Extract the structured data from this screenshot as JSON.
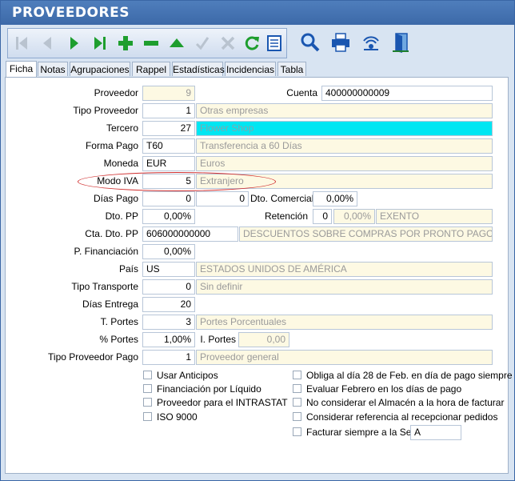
{
  "window": {
    "title": "PROVEEDORES"
  },
  "toolbar": {
    "buttons": [
      {
        "name": "first-record-button",
        "icon": "first-icon"
      },
      {
        "name": "previous-record-button",
        "icon": "previous-icon"
      },
      {
        "name": "next-record-button",
        "icon": "next-icon"
      },
      {
        "name": "last-record-button",
        "icon": "last-icon"
      },
      {
        "name": "add-record-button",
        "icon": "plus-icon"
      },
      {
        "name": "delete-record-button",
        "icon": "minus-icon"
      },
      {
        "name": "edit-record-button",
        "icon": "triangle-up-icon"
      },
      {
        "name": "confirm-button",
        "icon": "check-icon"
      },
      {
        "name": "cancel-button",
        "icon": "x-icon"
      },
      {
        "name": "refresh-button",
        "icon": "refresh-icon"
      },
      {
        "name": "list-view-button",
        "icon": "list-icon"
      },
      {
        "name": "search-button",
        "icon": "search-icon"
      },
      {
        "name": "print-button",
        "icon": "printer-icon"
      },
      {
        "name": "connect-button",
        "icon": "signal-icon"
      },
      {
        "name": "exit-button",
        "icon": "door-exit-icon"
      }
    ]
  },
  "tabs": [
    {
      "label": "Ficha",
      "active": true
    },
    {
      "label": "Notas"
    },
    {
      "label": "Agrupaciones"
    },
    {
      "label": "Rappel"
    },
    {
      "label": "Estadísticas"
    },
    {
      "label": "Incidencias"
    },
    {
      "label": "Tabla"
    }
  ],
  "form": {
    "proveedor": {
      "label": "Proveedor",
      "value": "9"
    },
    "cuenta": {
      "label": "Cuenta",
      "value": "400000000009"
    },
    "tipo_proveedor": {
      "label": "Tipo Proveedor",
      "code": "1",
      "desc": "Otras empresas"
    },
    "tercero": {
      "label": "Tercero",
      "code": "27",
      "desc": "Flower Shop"
    },
    "forma_pago": {
      "label": "Forma Pago",
      "code": "T60",
      "desc": "Transferencia a 60 Días"
    },
    "moneda": {
      "label": "Moneda",
      "code": "EUR",
      "desc": "Euros"
    },
    "modo_iva": {
      "label": "Modo IVA",
      "code": "5",
      "desc": "Extranjero"
    },
    "dias_pago": {
      "label": "Días Pago",
      "value1": "0",
      "value2": "0"
    },
    "dto_comercial": {
      "label": "Dto. Comercial",
      "value": "0,00%"
    },
    "dto_pp": {
      "label": "Dto. PP",
      "value": "0,00%"
    },
    "retencion": {
      "label": "Retención",
      "code": "0",
      "pct": "0,00%",
      "desc": "EXENTO"
    },
    "cta_dto_pp": {
      "label": "Cta. Dto. PP",
      "code": "606000000000",
      "desc": "DESCUENTOS SOBRE COMPRAS POR PRONTO PAGO DE M"
    },
    "p_financiacion": {
      "label": "P. Financiación",
      "value": "0,00%"
    },
    "pais": {
      "label": "País",
      "code": "US",
      "desc": "ESTADOS UNIDOS DE AMÉRICA"
    },
    "tipo_transporte": {
      "label": "Tipo Transporte",
      "code": "0",
      "desc": "Sin definir"
    },
    "dias_entrega": {
      "label": "Días Entrega",
      "value": "20"
    },
    "t_portes": {
      "label": "T. Portes",
      "code": "3",
      "desc": "Portes Porcentuales"
    },
    "pct_portes": {
      "label": "% Portes",
      "value": "1,00%"
    },
    "i_portes": {
      "label": "I. Portes",
      "value": "0,00"
    },
    "tipo_proveedor_pago": {
      "label": "Tipo Proveedor Pago",
      "code": "1",
      "desc": "Proveedor general"
    }
  },
  "checkboxes_left": [
    {
      "label": "Usar Anticipos",
      "checked": false
    },
    {
      "label": "Financiación por Líquido",
      "checked": false
    },
    {
      "label": "Proveedor para el INTRASTAT",
      "checked": false
    },
    {
      "label": "ISO 9000",
      "checked": false
    }
  ],
  "checkboxes_right": [
    {
      "label": "Obliga al día 28 de Feb. en día de pago siempre",
      "checked": false
    },
    {
      "label": "Evaluar Febrero en los días de pago",
      "checked": false
    },
    {
      "label": "No considerar el Almacén a la hora de facturar",
      "checked": false
    },
    {
      "label": "Considerar referencia al recepcionar pedidos",
      "checked": false
    },
    {
      "label": "Facturar siempre a la Serie",
      "checked": false
    }
  ],
  "serie": {
    "value": "A"
  },
  "colors": {
    "titlebar": "#3c69a8",
    "readonly": "#fdf9e3",
    "highlight": "#00e6f2",
    "accent_green": "#1e9e2e",
    "accent_blue": "#1a56b0"
  }
}
